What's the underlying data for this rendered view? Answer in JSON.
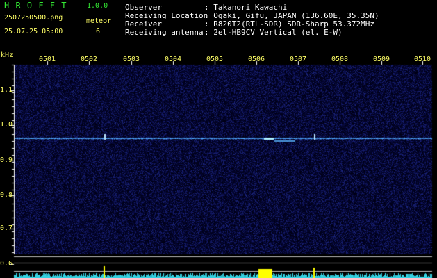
{
  "header": {
    "app_name": "H R O F F T",
    "version": "1.0.0",
    "filename": "2507250500.png",
    "meteor_label": "meteor",
    "meteor_count": "6",
    "datetime": "25.07.25 05:00",
    "info_labels": [
      "Observer",
      "Receiving Location",
      "Receiver",
      "Receiving antenna"
    ],
    "info_values": [
      ": Takanori Kawachi",
      ": Ogaki, Gifu, JAPAN (136.60E, 35.35N)",
      ": R820T2(RTL-SDR) SDR-Sharp 53.372MHz",
      ": 2el-HB9CV Vertical (el. E-W)"
    ]
  },
  "axis": {
    "y_unit": "kHz",
    "y_ticks": [
      "1.1",
      "1.0",
      "0.9",
      "0.8",
      "0.7",
      "0.6"
    ],
    "x_ticks": [
      "0501",
      "0502",
      "0503",
      "0504",
      "0505",
      "0506",
      "0507",
      "0508",
      "0509",
      "0510"
    ]
  },
  "colors": {
    "background": "#000000",
    "noise": "#10106a",
    "trace": "#4aa8ff",
    "meteor": "#ffff00",
    "axis_text": "#ffff66",
    "title_text": "#33e833"
  }
}
